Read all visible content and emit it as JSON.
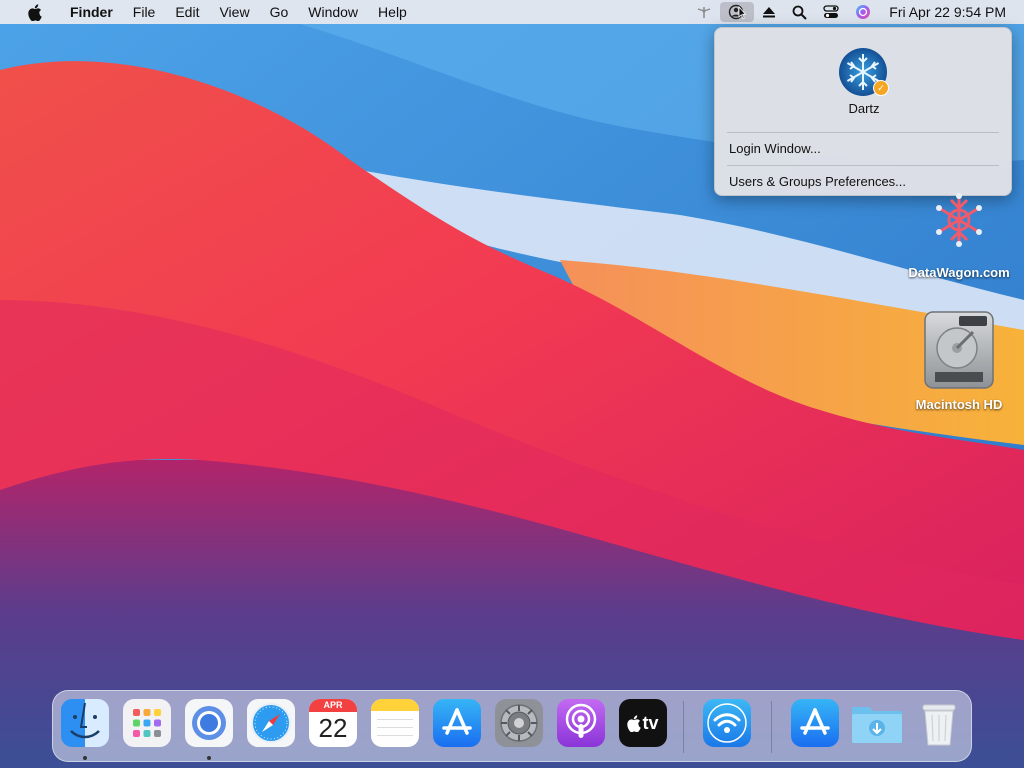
{
  "menubar": {
    "app_name": "Finder",
    "menus": [
      "File",
      "Edit",
      "View",
      "Go",
      "Window",
      "Help"
    ],
    "clock": "Fri Apr 22  9:54 PM"
  },
  "user_menu": {
    "username": "Dartz",
    "items": [
      "Login Window...",
      "Users & Groups Preferences..."
    ]
  },
  "desktop": {
    "icons": [
      {
        "label": "DataWagon.com"
      },
      {
        "label": "Macintosh HD"
      }
    ]
  },
  "dock": {
    "calendar_month": "APR",
    "calendar_day": "22",
    "tv_label": "tv",
    "apps": [
      "Finder",
      "Launchpad",
      "Chromium",
      "Safari",
      "Calendar",
      "Notes",
      "App Store",
      "System Preferences",
      "Podcasts",
      "Apple TV",
      "Wireless Diagnostics",
      "App Store",
      "Downloads",
      "Trash"
    ]
  },
  "colors": {
    "accent": "#1f7cf0",
    "badge": "#f5a623"
  }
}
